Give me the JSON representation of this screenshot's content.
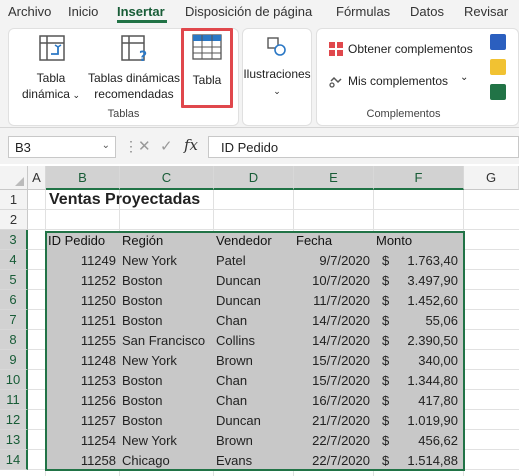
{
  "tabs": [
    "Archivo",
    "Inicio",
    "Insertar",
    "Disposición de página",
    "Fórmulas",
    "Datos",
    "Revisar"
  ],
  "ribbon": {
    "tabla_dinamica": [
      "Tabla",
      "dinámica"
    ],
    "tablas_recomendadas": [
      "Tablas dinámicas",
      "recomendadas"
    ],
    "tabla": "Tabla",
    "ilustraciones": "Ilustraciones",
    "obtener_complementos": "Obtener complementos",
    "mis_complementos": "Mis complementos",
    "group_tablas": "Tablas",
    "group_complementos": "Complementos"
  },
  "formula_bar": {
    "name_box": "B3",
    "formula": "ID Pedido",
    "fx": "fx"
  },
  "sheet": {
    "columns": [
      "A",
      "B",
      "C",
      "D",
      "E",
      "F",
      "G"
    ],
    "rows": [
      "1",
      "2",
      "3",
      "4",
      "5",
      "6",
      "7",
      "8",
      "9",
      "10",
      "11",
      "12",
      "13",
      "14"
    ],
    "title": "Ventas Proyectadas",
    "headers": [
      "ID Pedido",
      "Región",
      "Vendedor",
      "Fecha",
      "Monto"
    ],
    "currency": "$",
    "data": [
      [
        "11249",
        "New York",
        "Patel",
        "9/7/2020",
        "1.763,40"
      ],
      [
        "11252",
        "Boston",
        "Duncan",
        "10/7/2020",
        "3.497,90"
      ],
      [
        "11250",
        "Boston",
        "Duncan",
        "11/7/2020",
        "1.452,60"
      ],
      [
        "11251",
        "Boston",
        "Chan",
        "14/7/2020",
        "55,06"
      ],
      [
        "11255",
        "San Francisco",
        "Collins",
        "14/7/2020",
        "2.390,50"
      ],
      [
        "11248",
        "New York",
        "Brown",
        "15/7/2020",
        "340,00"
      ],
      [
        "11253",
        "Boston",
        "Chan",
        "15/7/2020",
        "1.344,80"
      ],
      [
        "11256",
        "Boston",
        "Chan",
        "16/7/2020",
        "417,80"
      ],
      [
        "11257",
        "Boston",
        "Duncan",
        "21/7/2020",
        "1.019,90"
      ],
      [
        "11254",
        "New York",
        "Brown",
        "22/7/2020",
        "456,62"
      ],
      [
        "11258",
        "Chicago",
        "Evans",
        "22/7/2020",
        "1.514,88"
      ]
    ]
  },
  "colors": {
    "excel_green": "#217346",
    "highlight": "#e0474c",
    "selection_fill": "#c8c8c8"
  }
}
